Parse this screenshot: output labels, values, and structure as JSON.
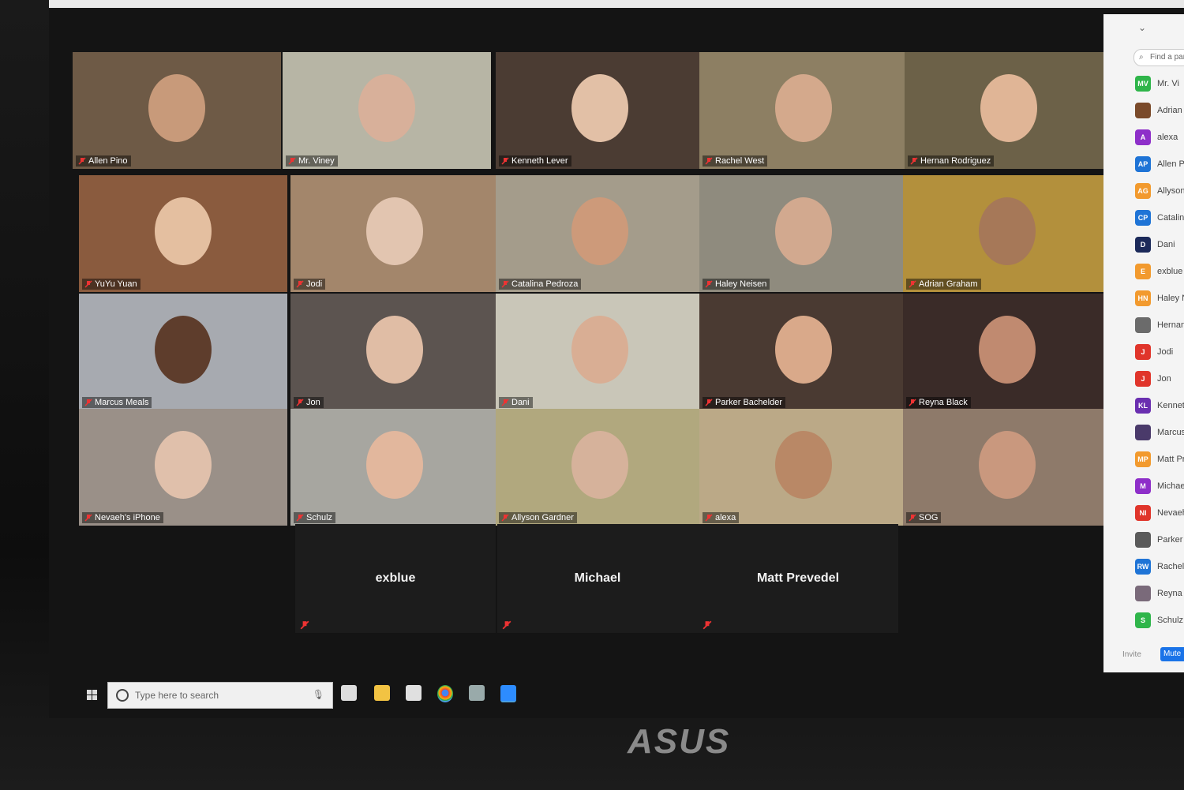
{
  "tiles": [
    {
      "name": "Allen Pino",
      "bg": "#6e5a46",
      "face": "#c89a7a"
    },
    {
      "name": "Mr. Viney",
      "bg": "#b7b5a5",
      "face": "#d8b09a",
      "active": true
    },
    {
      "name": "Kenneth Lever",
      "bg": "#4b3c33",
      "face": "#e2c0a6"
    },
    {
      "name": "Rachel West",
      "bg": "#8d7f63",
      "face": "#d4a98c"
    },
    {
      "name": "Hernan Rodriguez",
      "bg": "#6c6148",
      "face": "#e0b596"
    },
    {
      "name": "YuYu Yuan",
      "bg": "#8a5b3e",
      "face": "#e4bfa0"
    },
    {
      "name": "Jodi",
      "bg": "#a3866b",
      "face": "#e2c5b0"
    },
    {
      "name": "Catalina Pedroza",
      "bg": "#a49c8b",
      "face": "#cd9a7a"
    },
    {
      "name": "Haley Neisen",
      "bg": "#8f8b7e",
      "face": "#d2a98f"
    },
    {
      "name": "Adrian Graham",
      "bg": "#b3903c",
      "face": "#a67858"
    },
    {
      "name": "Marcus Meals",
      "bg": "#a7aab0",
      "face": "#5e3d2c"
    },
    {
      "name": "Jon",
      "bg": "#5c5450",
      "face": "#e0bda5"
    },
    {
      "name": "Dani",
      "bg": "#c9c6b8",
      "face": "#d9ae94"
    },
    {
      "name": "Parker Bachelder",
      "bg": "#4a3a32",
      "face": "#d9a98a"
    },
    {
      "name": "Reyna Black",
      "bg": "#3a2b28",
      "face": "#c08a70"
    },
    {
      "name": "Nevaeh's iPhone",
      "bg": "#9a9088",
      "face": "#e0c0ab"
    },
    {
      "name": "Schulz",
      "bg": "#a7a6a0",
      "face": "#e2b79d"
    },
    {
      "name": "Allyson Gardner",
      "bg": "#b1a87e",
      "face": "#d6b29b"
    },
    {
      "name": "alexa",
      "bg": "#bba987",
      "face": "#b98866"
    },
    {
      "name": "SOG",
      "bg": "#8e7a6a",
      "face": "#c9987e"
    }
  ],
  "blank_tiles": [
    "exblue",
    "Michael",
    "Matt Prevedel"
  ],
  "panel": {
    "search_placeholder": "Find a par",
    "participants": [
      {
        "initials": "MV",
        "name": "Mr. Vi",
        "color": "#2fb54a"
      },
      {
        "initials": "",
        "name": "Adrian",
        "color": "#7a4a2a"
      },
      {
        "initials": "A",
        "name": "alexa",
        "color": "#8e2fc9"
      },
      {
        "initials": "AP",
        "name": "Allen P",
        "color": "#1f74d6"
      },
      {
        "initials": "AG",
        "name": "Allyson",
        "color": "#f29a2e"
      },
      {
        "initials": "CP",
        "name": "Catalina",
        "color": "#1f74d6"
      },
      {
        "initials": "D",
        "name": "Dani",
        "color": "#1c2a5a"
      },
      {
        "initials": "E",
        "name": "exblue",
        "color": "#f29a2e"
      },
      {
        "initials": "HN",
        "name": "Haley N",
        "color": "#f29a2e"
      },
      {
        "initials": "",
        "name": "Hernan F",
        "color": "#6b6b6b"
      },
      {
        "initials": "J",
        "name": "Jodi",
        "color": "#e0352b"
      },
      {
        "initials": "J",
        "name": "Jon",
        "color": "#e0352b"
      },
      {
        "initials": "KL",
        "name": "Kenneth L",
        "color": "#6a2fb0"
      },
      {
        "initials": "",
        "name": "Marcus M",
        "color": "#4a3a6a"
      },
      {
        "initials": "MP",
        "name": "Matt Preve",
        "color": "#f29a2e"
      },
      {
        "initials": "M",
        "name": "Michael",
        "color": "#8e2fc9"
      },
      {
        "initials": "NI",
        "name": "Nevaeh's i",
        "color": "#e0352b"
      },
      {
        "initials": "",
        "name": "Parker Bach",
        "color": "#5a5a5a"
      },
      {
        "initials": "RW",
        "name": "Rachel Wes",
        "color": "#1f74d6"
      },
      {
        "initials": "",
        "name": "Reyna Black",
        "color": "#7a6a7a"
      },
      {
        "initials": "S",
        "name": "Schulz",
        "color": "#2fb54a"
      }
    ],
    "invite_label": "Invite",
    "mute_label": "Mute"
  },
  "taskbar": {
    "search_placeholder": "Type here to search"
  },
  "brand": "ASUS"
}
